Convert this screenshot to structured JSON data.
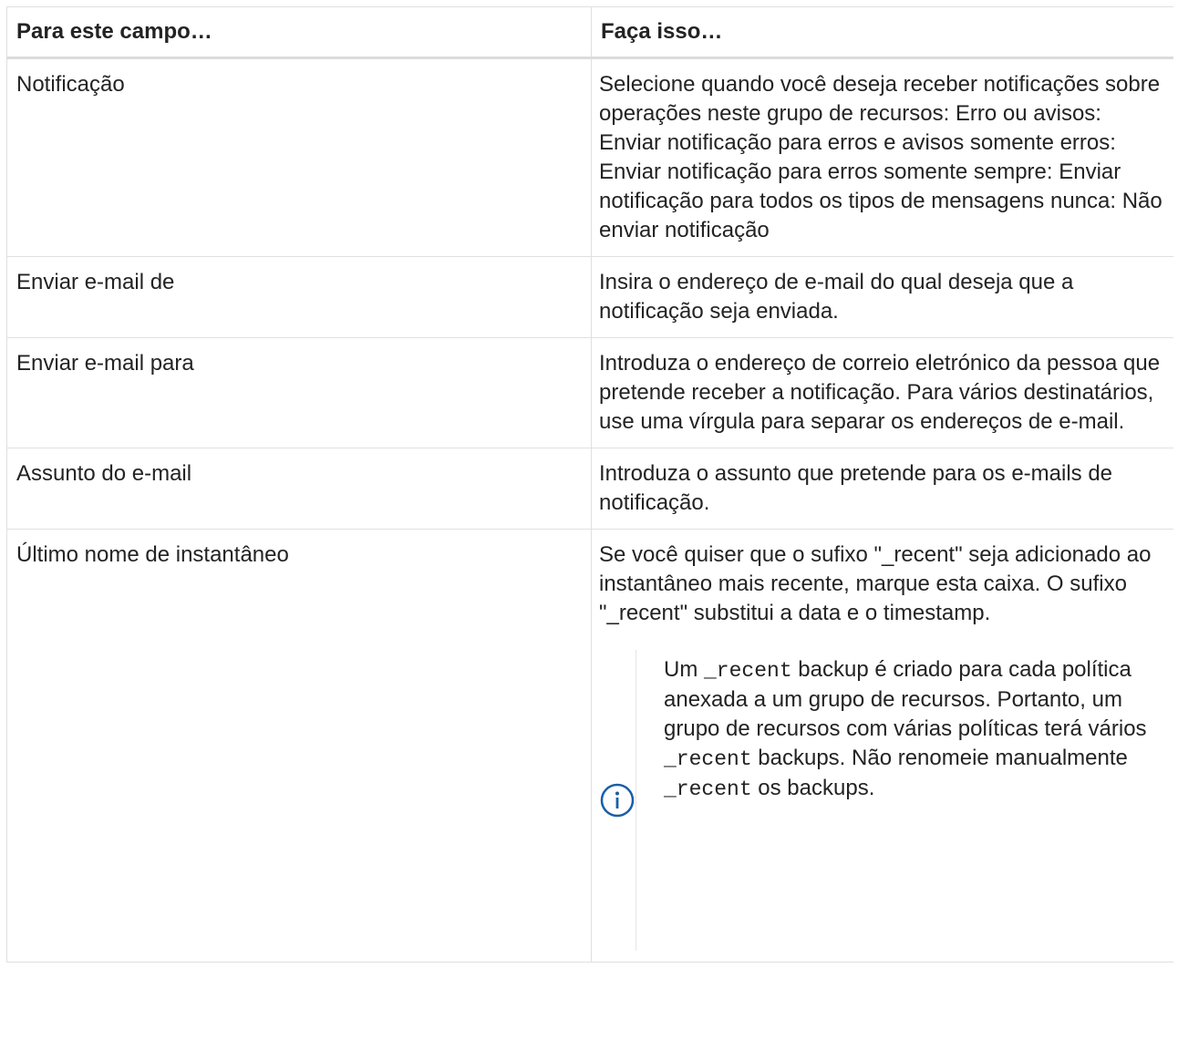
{
  "table": {
    "headers": [
      "Para este campo…",
      "Faça isso…"
    ],
    "rows": [
      {
        "field": "Notificação",
        "action": "Selecione quando você deseja receber notificações sobre operações neste grupo de recursos: Erro ou avisos: Enviar notificação para erros e avisos somente erros: Enviar notificação para erros somente sempre: Enviar notificação para todos os tipos de mensagens nunca: Não enviar notificação"
      },
      {
        "field": "Enviar e-mail de",
        "action": "Insira o endereço de e-mail do qual deseja que a notificação seja enviada."
      },
      {
        "field": "Enviar e-mail para",
        "action": "Introduza o endereço de correio eletrónico da pessoa que pretende receber a notificação. Para vários destinatários, use uma vírgula para separar os endereços de e-mail."
      },
      {
        "field": "Assunto do e-mail",
        "action": "Introduza o assunto que pretende para os e-mails de notificação."
      },
      {
        "field": "Último nome de instantâneo",
        "action": "Se você quiser que o sufixo \"_recent\" seja adicionado ao instantâneo mais recente, marque esta caixa. O sufixo \"_recent\" substitui a data e o timestamp."
      }
    ],
    "note": {
      "icon": "info-circle-icon",
      "icon_color": "#1a5ea8",
      "part1": "Um ",
      "code1": "_recent",
      "part2": " backup é criado para cada política anexada a um grupo de recursos. Portanto, um grupo de recursos com várias políticas terá vários ",
      "code2": "_recent",
      "part3": " backups. Não renomeie manualmente ",
      "code3": "_recent",
      "part4": " os backups."
    }
  }
}
